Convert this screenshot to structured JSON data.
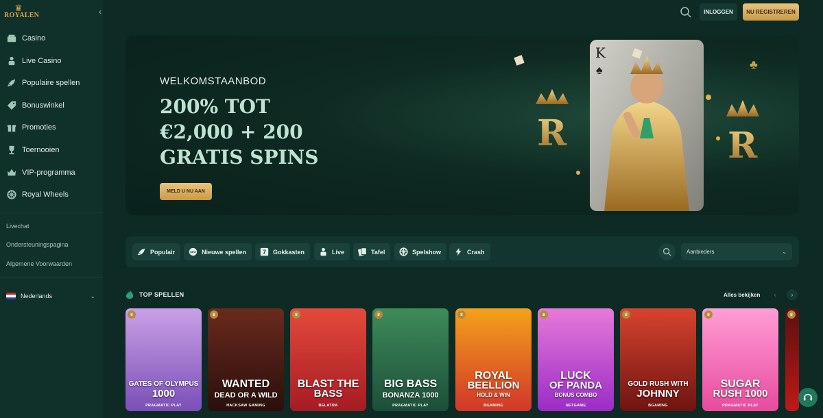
{
  "brand": {
    "name": "ROYALEN"
  },
  "sidebar": {
    "items": [
      {
        "label": "Casino",
        "icon": "casino-icon"
      },
      {
        "label": "Live Casino",
        "icon": "dealer-icon"
      },
      {
        "label": "Populaire spellen",
        "icon": "rocket-icon"
      },
      {
        "label": "Bonuswinkel",
        "icon": "tag-icon"
      },
      {
        "label": "Promoties",
        "icon": "gift-icon"
      },
      {
        "label": "Toernooien",
        "icon": "trophy-icon"
      },
      {
        "label": "VIP-programma",
        "icon": "crown-icon"
      },
      {
        "label": "Royal Wheels",
        "icon": "wheel-icon"
      }
    ],
    "links": [
      "Livechat",
      "Ondersteuningspagina",
      "Algemene Voorwaarden"
    ],
    "language": "Nederlands"
  },
  "header": {
    "login": "INLOGGEN",
    "register": "NU REGISTREREN"
  },
  "hero": {
    "eyebrow": "WELKOMSTAANBOD",
    "title_line1": "200% TOT",
    "title_line2": "€2,000 + 200",
    "title_line3": "GRATIS SPINS",
    "cta": "MELD U NU AAN"
  },
  "filters": {
    "chips": [
      {
        "label": "Populair",
        "icon": "rocket-icon"
      },
      {
        "label": "Nieuwe spellen",
        "icon": "new-icon"
      },
      {
        "label": "Gokkasten",
        "icon": "slot-seven-icon"
      },
      {
        "label": "Live",
        "icon": "dealer-icon"
      },
      {
        "label": "Tafel",
        "icon": "cards-icon"
      },
      {
        "label": "Spelshow",
        "icon": "wheel-icon"
      },
      {
        "label": "Crash",
        "icon": "lightning-icon"
      }
    ],
    "providers_placeholder": "Aanbieders"
  },
  "top_games": {
    "title": "TOP SPELLEN",
    "see_all": "Alles bekijken",
    "games": [
      {
        "line1": "GATES OF OLYMPUS",
        "line2": "1000",
        "provider": "PRAGMATIC PLAY",
        "colors": [
          "#c9a0e6",
          "#7a4fb8"
        ]
      },
      {
        "line1": "WANTED",
        "line2": "DEAD OR A WILD",
        "provider": "HACKSAW GAMING",
        "colors": [
          "#6a2a1e",
          "#2a0f0c"
        ]
      },
      {
        "line1": "BLAST THE",
        "line2": "BASS",
        "provider": "BELATRA",
        "colors": [
          "#e44a3a",
          "#a51b24"
        ]
      },
      {
        "line1": "BIG BASS",
        "line2": "BONANZA 1000",
        "provider": "PRAGMATIC PLAY",
        "colors": [
          "#3e8c5a",
          "#1c4e3a"
        ]
      },
      {
        "line1": "ROYAL",
        "line2": "BEELLION",
        "sub": "HOLD & WIN",
        "provider": "BGAMING",
        "colors": [
          "#f3a21a",
          "#d2362a"
        ]
      },
      {
        "line1": "LUCK",
        "line2": "OF PANDA",
        "sub": "BONUS COMBO",
        "provider": "NETGAME",
        "colors": [
          "#e77ad8",
          "#9a2cc7"
        ]
      },
      {
        "line1": "GOLD RUSH WITH",
        "line2": "JOHNNY",
        "provider": "BGAMING",
        "colors": [
          "#d8432e",
          "#6e1412"
        ]
      },
      {
        "line1": "SUGAR",
        "line2": "RUSH 1000",
        "provider": "PRAGMATIC PLAY",
        "colors": [
          "#ff9ed6",
          "#e84a9e"
        ]
      }
    ]
  }
}
